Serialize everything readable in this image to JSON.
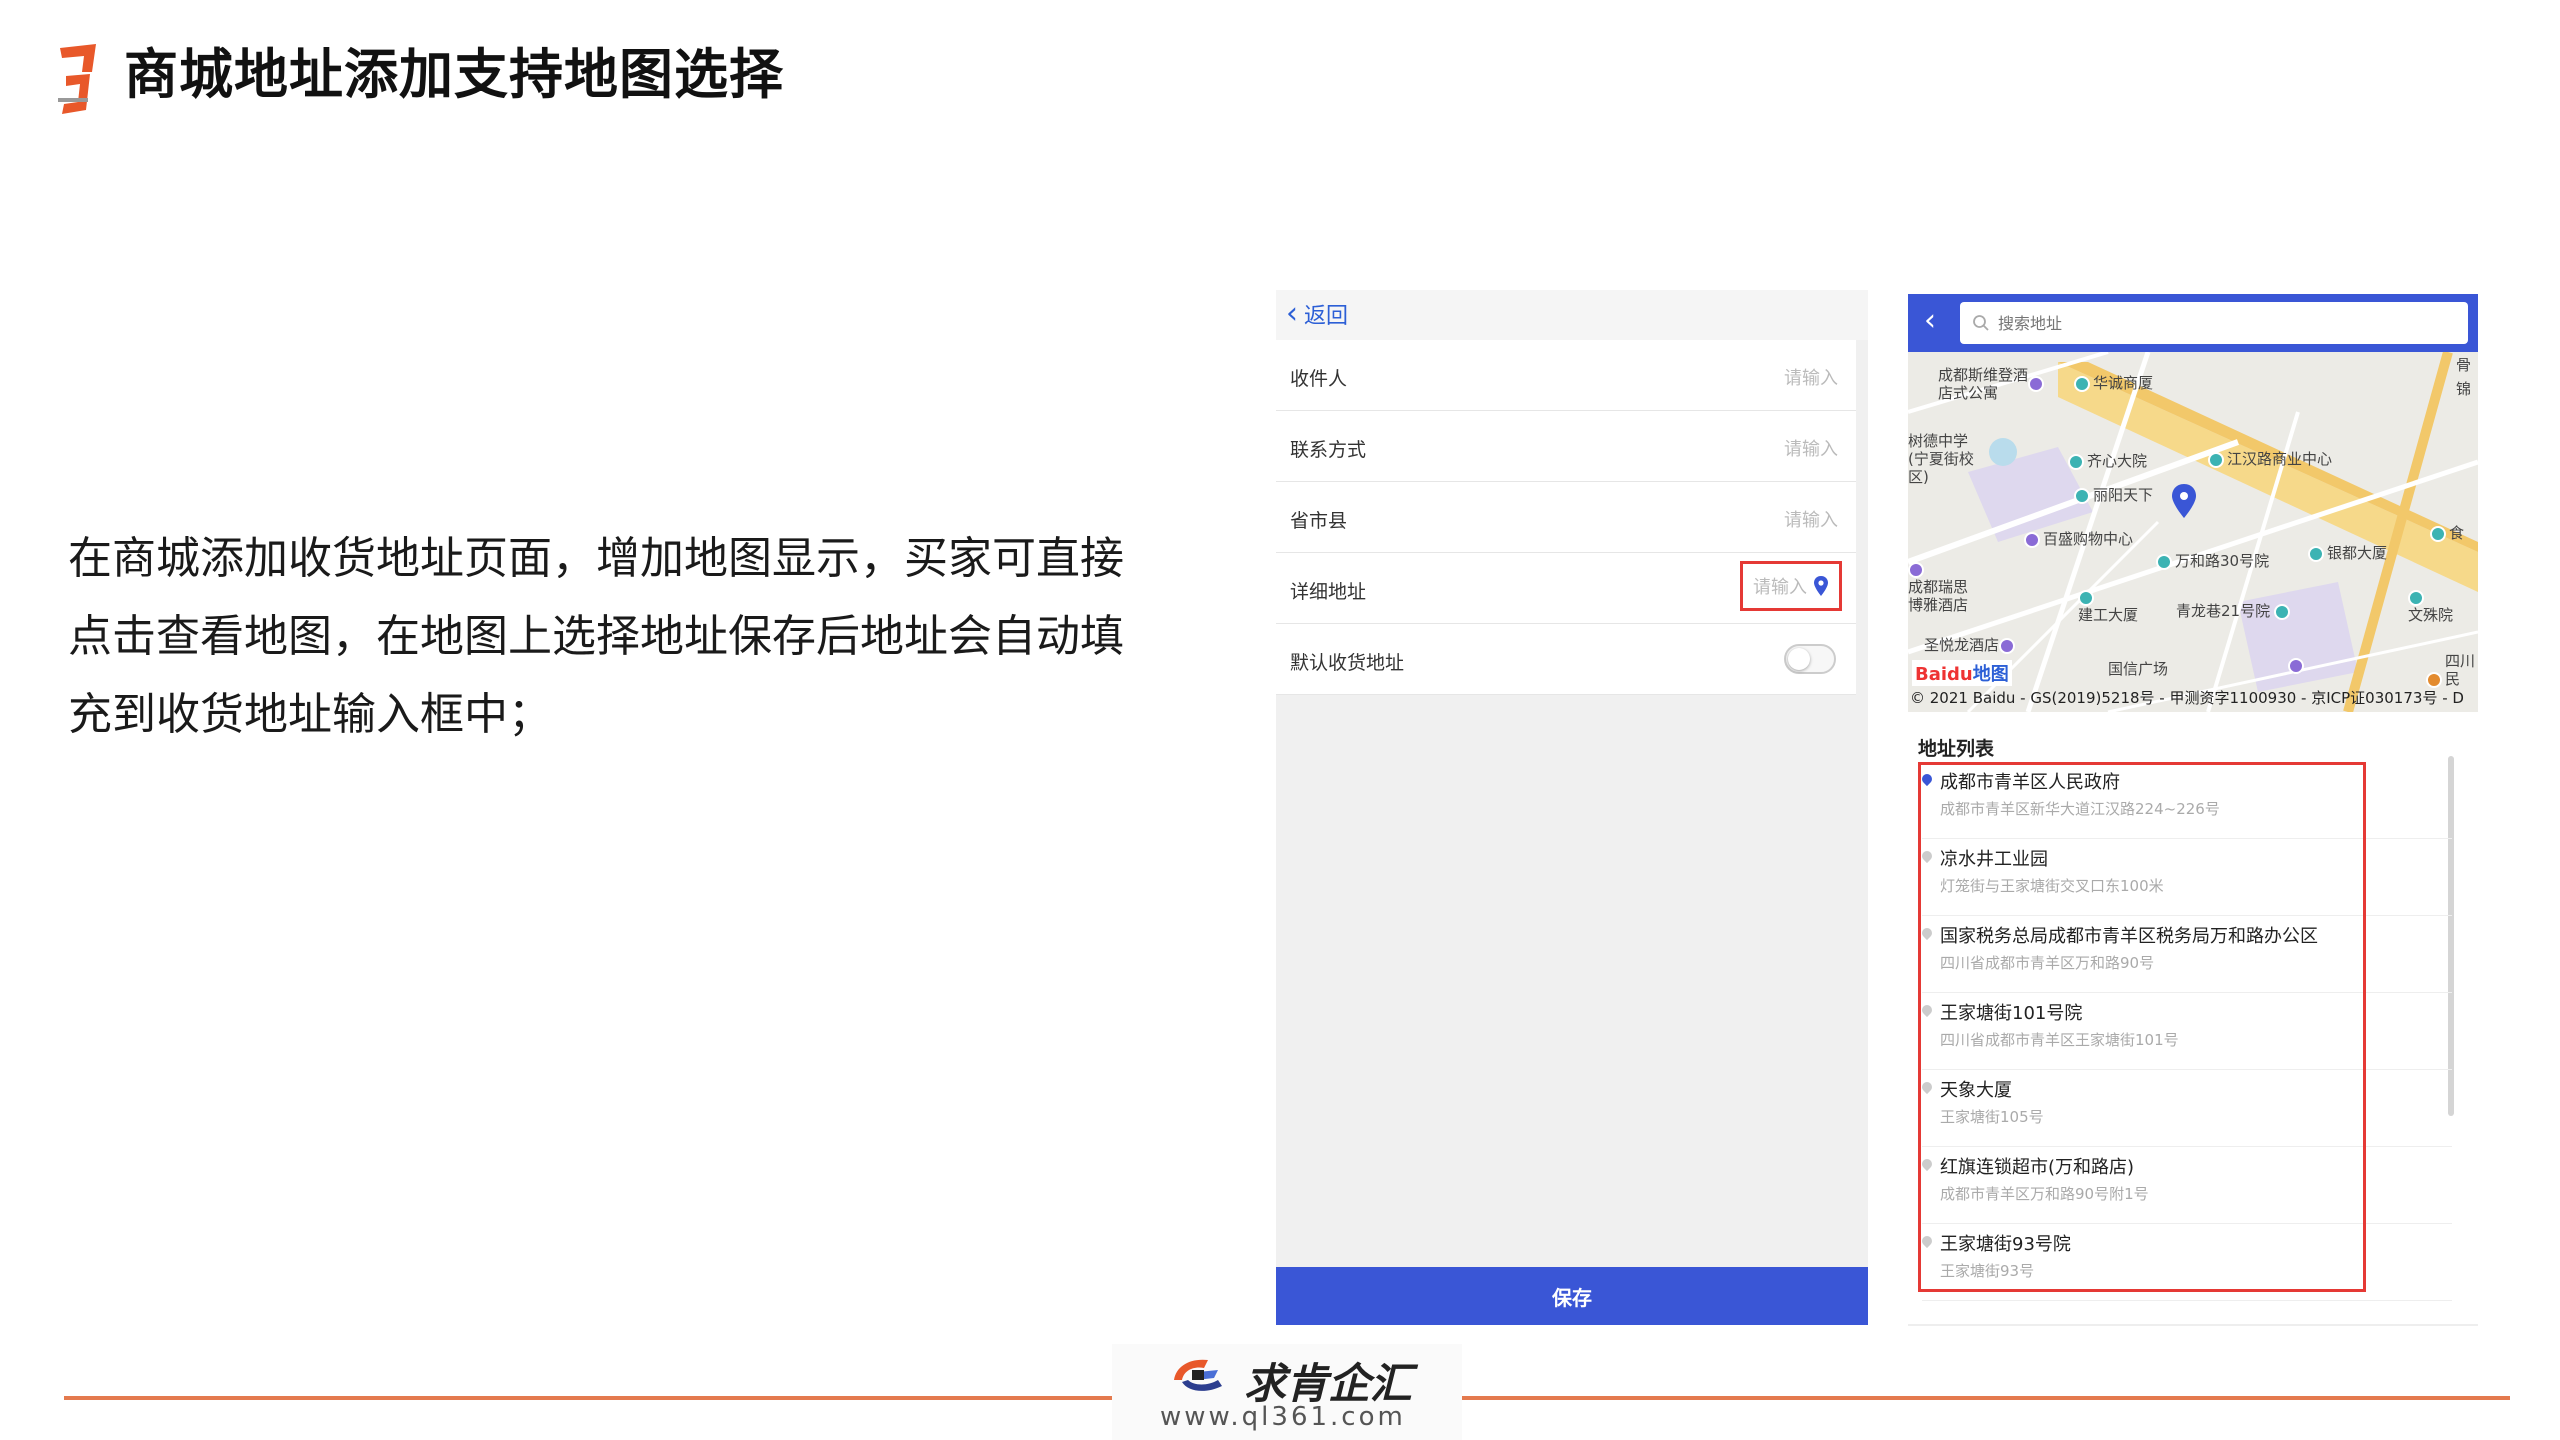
{
  "title": "商城地址添加支持地图选择",
  "description": "在商城添加收货地址页面，增加地图显示，买家可直接点击查看地图，在地图上选择地址保存后地址会自动填充到收货地址输入框中；",
  "colors": {
    "accent": "#3a56d6",
    "highlight": "#e53935",
    "brand": "#e47a4e"
  },
  "address_form": {
    "back_label": "返回",
    "fields": [
      {
        "label": "收件人",
        "placeholder": "请输入"
      },
      {
        "label": "联系方式",
        "placeholder": "请输入"
      },
      {
        "label": "省市县",
        "placeholder": "请输入"
      },
      {
        "label": "详细地址",
        "placeholder": "请输入",
        "icon": "location-pin-icon"
      },
      {
        "label": "默认收货地址",
        "type": "toggle"
      }
    ],
    "save_label": "保存"
  },
  "map_picker": {
    "search_placeholder": "搜索地址",
    "pois": [
      {
        "label": "成都斯维登酒店式公寓"
      },
      {
        "label": "华诚商厦"
      },
      {
        "label": "树德中学(宁夏街校区)"
      },
      {
        "label": "齐心大院"
      },
      {
        "label": "江汉路商业中心"
      },
      {
        "label": "丽阳天下"
      },
      {
        "label": "百盛购物中心"
      },
      {
        "label": "万和路30号院"
      },
      {
        "label": "银都大厦"
      },
      {
        "label": "成都瑞思博雅酒店"
      },
      {
        "label": "建工大厦"
      },
      {
        "label": "青龙巷21号院"
      },
      {
        "label": "文殊院"
      },
      {
        "label": "圣悦龙酒店"
      },
      {
        "label": "国信广场"
      },
      {
        "label": "骨"
      },
      {
        "label": "锦"
      },
      {
        "label": "食"
      },
      {
        "label": "四川民"
      }
    ],
    "baidu_logo": "Baidu地图",
    "copyright": "© 2021 Baidu - GS(2019)5218号 - 甲测资字1100930 - 京ICP证030173号 - D",
    "list_title": "地址列表",
    "addresses": [
      {
        "name": "成都市青羊区人民政府",
        "detail": "成都市青羊区新华大道江汉路224~226号"
      },
      {
        "name": "凉水井工业园",
        "detail": "灯笼街与王家塘街交叉口东100米"
      },
      {
        "name": "国家税务总局成都市青羊区税务局万和路办公区",
        "detail": "四川省成都市青羊区万和路90号"
      },
      {
        "name": "王家塘街101号院",
        "detail": "四川省成都市青羊区王家塘街101号"
      },
      {
        "name": "天象大厦",
        "detail": "王家塘街105号"
      },
      {
        "name": "红旗连锁超市(万和路店)",
        "detail": "成都市青羊区万和路90号附1号"
      },
      {
        "name": "王家塘街93号院",
        "detail": "王家塘街93号"
      }
    ]
  },
  "footer": {
    "brand": "求肯企汇",
    "url": "www.ql361.com"
  }
}
